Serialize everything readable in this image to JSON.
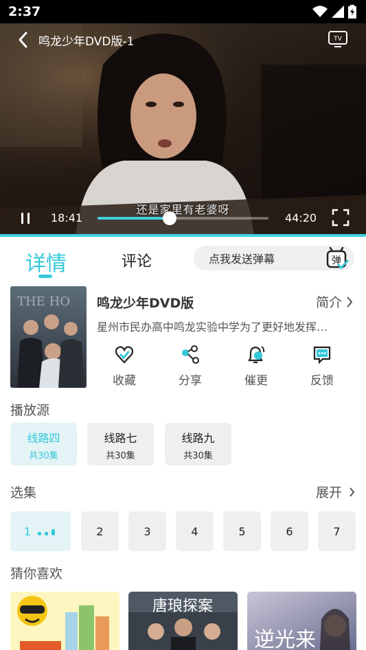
{
  "status": {
    "time": "2:37"
  },
  "player": {
    "title": "鸣龙少年DVD版-1",
    "subtitle": "还是家里有老婆呀",
    "current_time": "18:41",
    "duration": "44:20",
    "progress": 0.42
  },
  "tabs": {
    "detail": "详情",
    "comments": "评论",
    "danmaku_placeholder": "点我发送弹幕",
    "danmaku_icon_text": "弹"
  },
  "show": {
    "title": "鸣龙少年DVD版",
    "intro_label": "简介",
    "description": "星州市民办高中鸣龙实验中学为了更好地发挥…",
    "poster_text": "THE HO",
    "actions": [
      {
        "label": "收藏",
        "icon": "heart-icon"
      },
      {
        "label": "分享",
        "icon": "share-icon"
      },
      {
        "label": "催更",
        "icon": "bell-icon"
      },
      {
        "label": "反馈",
        "icon": "feedback-icon"
      }
    ]
  },
  "sources": {
    "title": "播放源",
    "items": [
      {
        "name": "线路四",
        "count": "共30集"
      },
      {
        "name": "线路七",
        "count": "共30集"
      },
      {
        "name": "线路九",
        "count": "共30集"
      }
    ]
  },
  "episodes": {
    "title": "选集",
    "expand_label": "展开",
    "items": [
      "1",
      "2",
      "3",
      "4",
      "5",
      "6",
      "7"
    ]
  },
  "recommend": {
    "title": "猜你喜欢",
    "items": [
      {
        "poster_text": ""
      },
      {
        "poster_text": "唐琅探案"
      },
      {
        "poster_text": "逆光来"
      }
    ]
  },
  "colors": {
    "accent": "#35c8da",
    "accent_bg": "#e3f3f6",
    "chip_bg": "#eeeff1"
  }
}
